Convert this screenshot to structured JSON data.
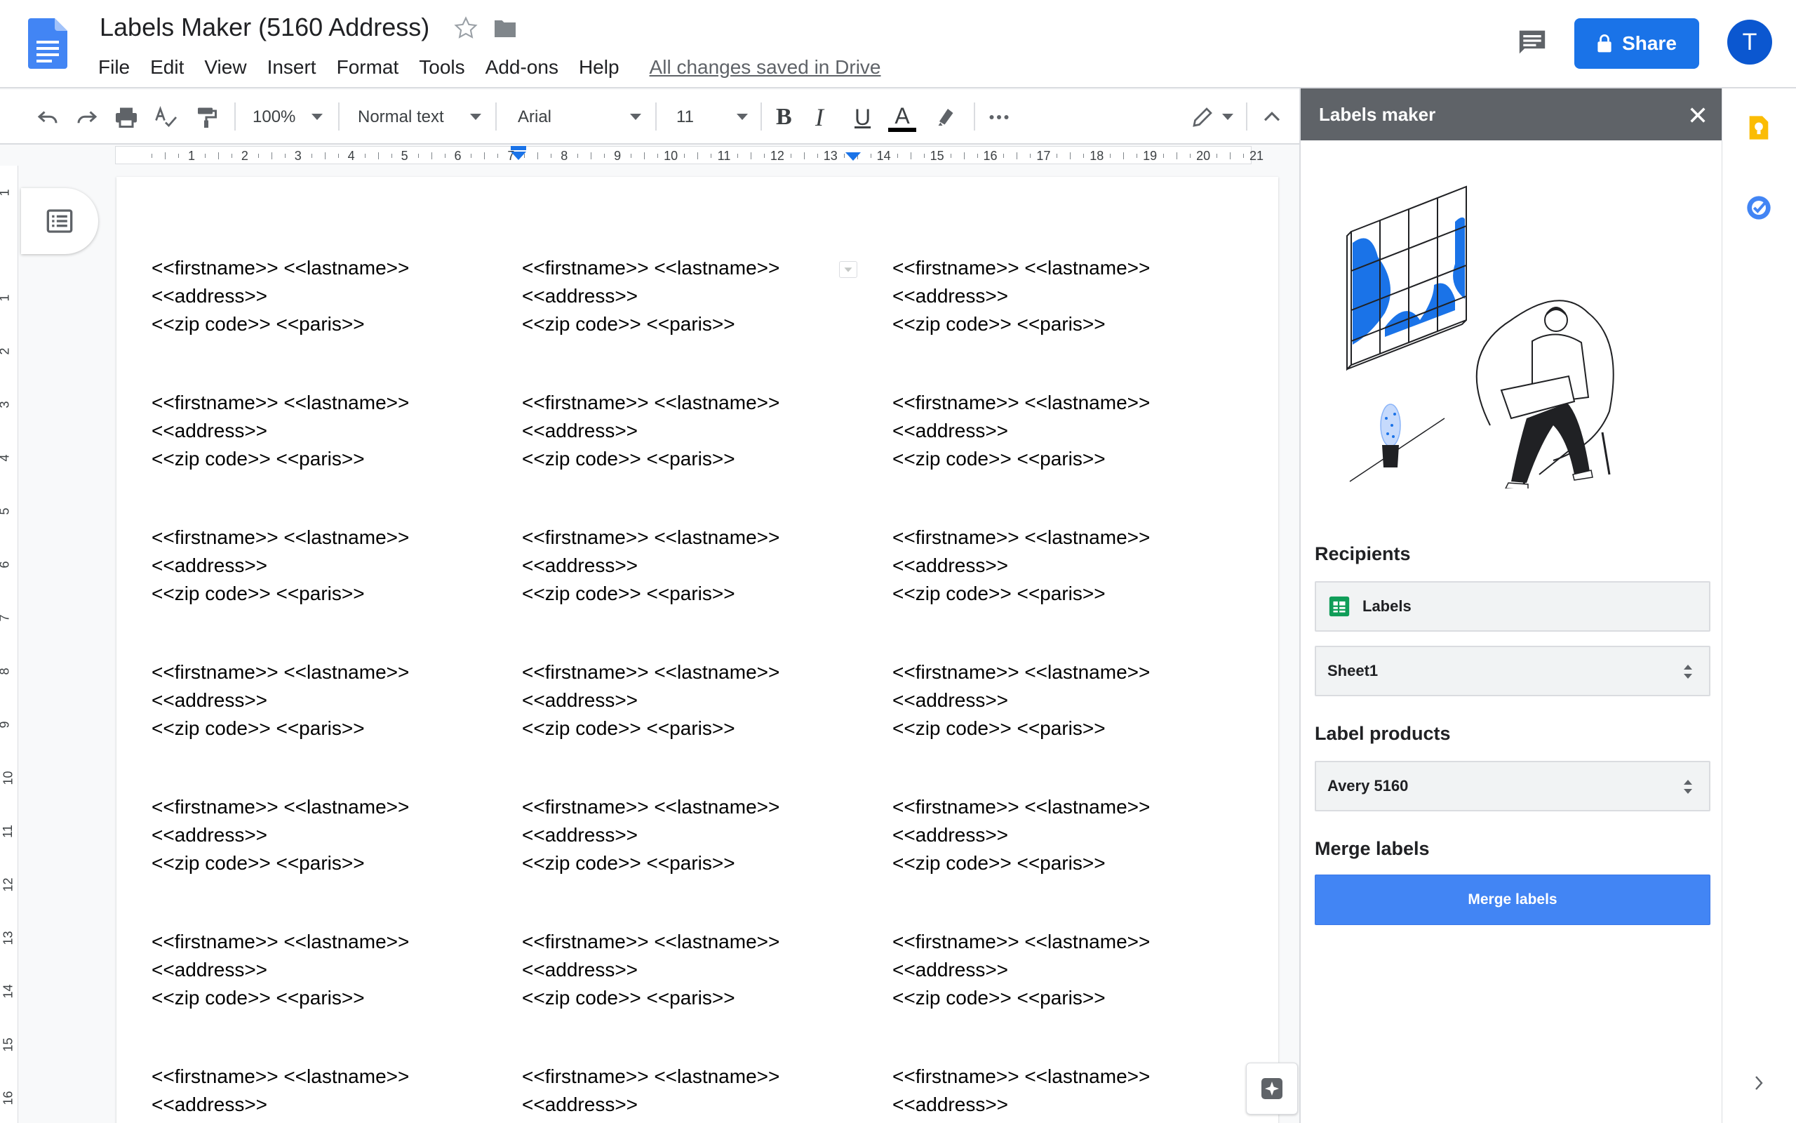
{
  "document": {
    "title": "Labels Maker (5160 Address)",
    "menu": [
      "File",
      "Edit",
      "View",
      "Insert",
      "Format",
      "Tools",
      "Add-ons",
      "Help"
    ],
    "save_status": "All changes saved in Drive"
  },
  "header": {
    "share_label": "Share",
    "avatar_initial": "T",
    "share_color": "#1a73e8"
  },
  "toolbar": {
    "zoom": "100%",
    "style": "Normal text",
    "font": "Arial",
    "font_size": "11",
    "bold": "B",
    "italic": "I",
    "underline": "U",
    "text_color": "A"
  },
  "ruler": {
    "numbers": [
      "1",
      "2",
      "3",
      "4",
      "5",
      "6",
      "7",
      "8",
      "9",
      "10",
      "11",
      "12",
      "13",
      "14",
      "15",
      "16",
      "17",
      "18",
      "19",
      "20",
      "21"
    ],
    "vertical_numbers": [
      "1",
      "1",
      "2",
      "3",
      "4",
      "5",
      "6",
      "7",
      "8",
      "9",
      "10",
      "11",
      "12",
      "13",
      "14",
      "15",
      "16"
    ]
  },
  "labels": {
    "line1": "<<firstname>> <<lastname>>",
    "line2": "<<address>>",
    "line3": "<<zip code>> <<paris>>"
  },
  "sidepanel": {
    "title": "Labels maker",
    "recipients_heading": "Recipients",
    "spreadsheet_name": "Labels",
    "sheet_name": "Sheet1",
    "label_products_heading": "Label products",
    "label_product": "Avery 5160",
    "merge_heading": "Merge labels",
    "merge_button": "Merge labels",
    "merge_button_color": "#4285f4",
    "header_color": "#5f6368"
  }
}
